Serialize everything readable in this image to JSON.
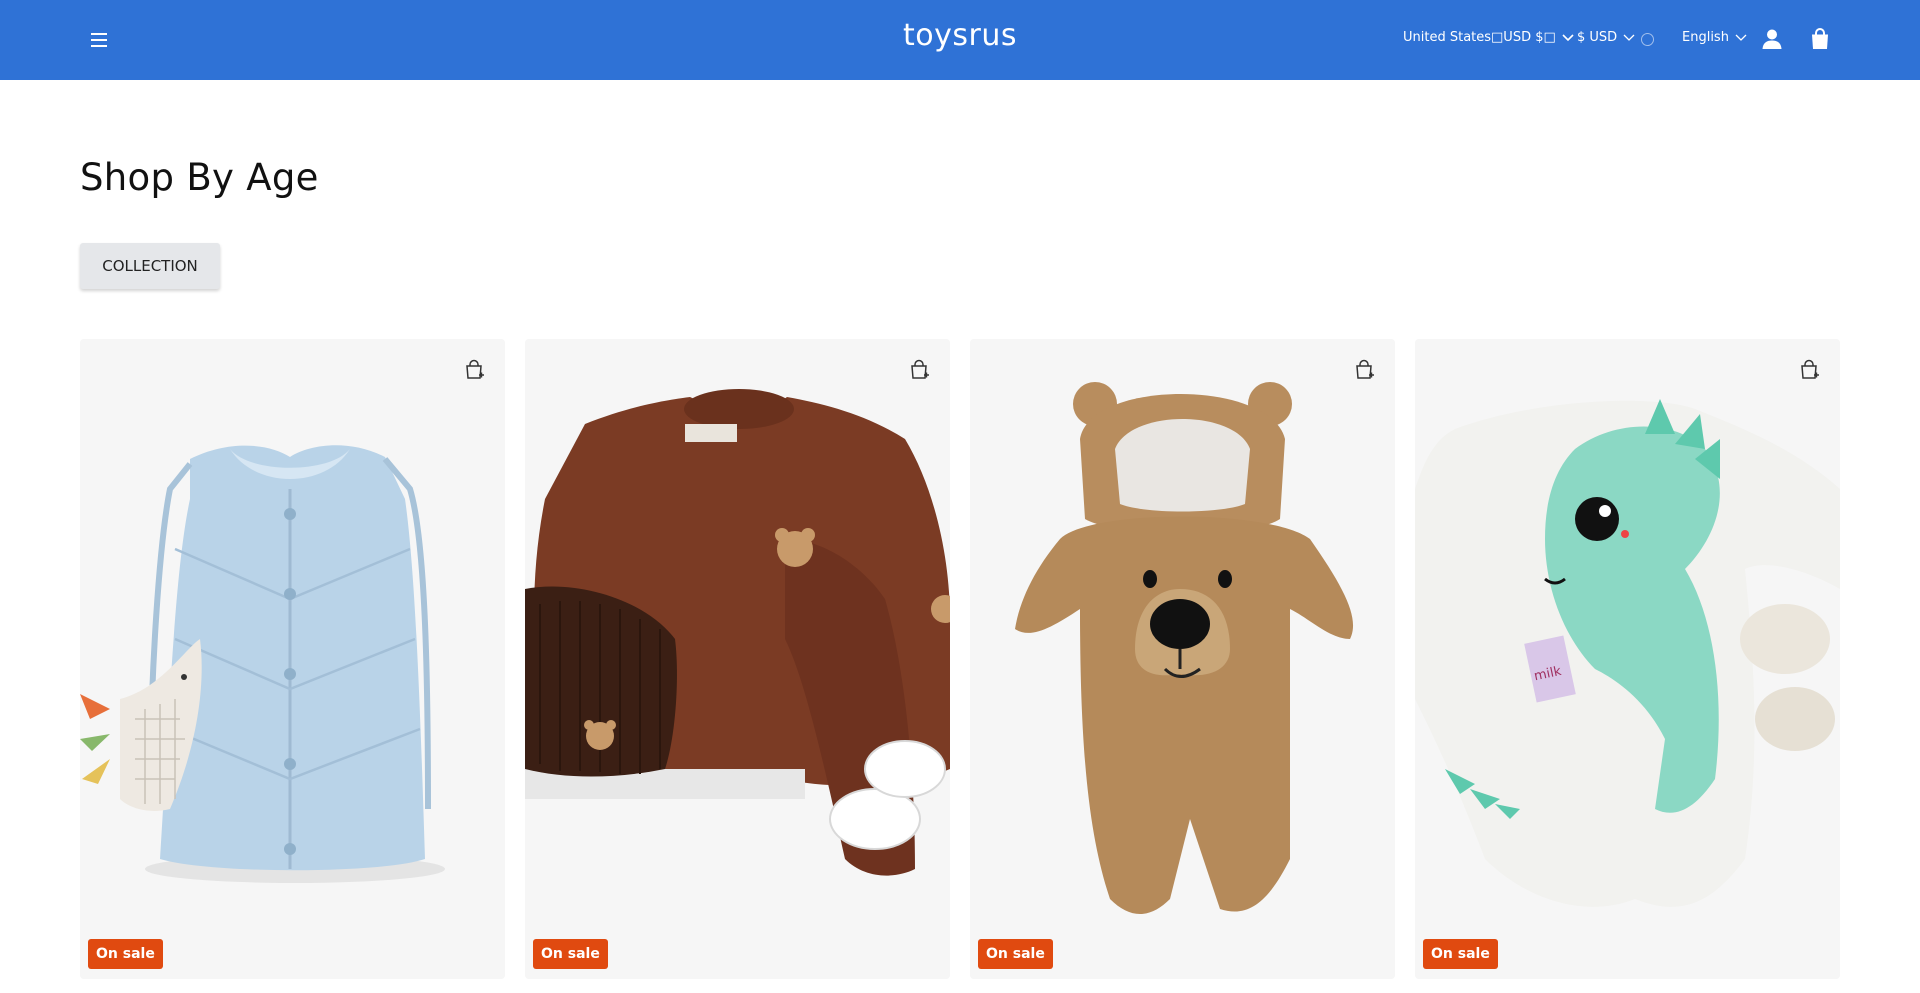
{
  "header": {
    "logo_text": "toysrus",
    "country_selector": "United States\u0000USD $\u0000",
    "country_selector_display": "United States□USD $□",
    "currency_selector": "$ USD",
    "language_selector": "English",
    "icons": [
      "menu-icon",
      "chevron-down-icon",
      "info-icon",
      "account-icon",
      "cart-icon"
    ]
  },
  "main": {
    "title": "Shop By Age",
    "collection_button": "COLLECTION"
  },
  "products": [
    {
      "image": "light blue quilted kids vest with dino pocket",
      "badge": "On sale"
    },
    {
      "image": "brown bear sweatshirt set with beanie and shoes",
      "badge": "On sale"
    },
    {
      "image": "brown bear plush hooded baby romper",
      "badge": "On sale"
    },
    {
      "image": "white dinosaur baby romper with shoes",
      "badge": "On sale"
    }
  ],
  "colors": {
    "header_bg": "#2f72d6",
    "badge_bg": "#e04a10",
    "button_bg": "#e5e7ea",
    "card_bg": "#f6f6f6"
  }
}
